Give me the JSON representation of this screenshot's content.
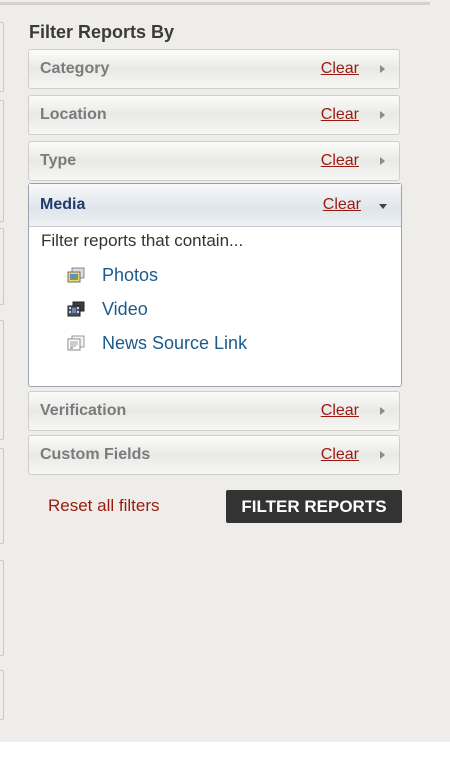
{
  "panel": {
    "title": "Filter Reports By",
    "filters": [
      {
        "label": "Category",
        "clear": "Clear"
      },
      {
        "label": "Location",
        "clear": "Clear"
      },
      {
        "label": "Type",
        "clear": "Clear"
      },
      {
        "label": "Media",
        "clear": "Clear",
        "expanded": true
      },
      {
        "label": "Verification",
        "clear": "Clear"
      },
      {
        "label": "Custom Fields",
        "clear": "Clear"
      }
    ],
    "media": {
      "intro": "Filter reports that contain...",
      "options": [
        {
          "label": "Photos",
          "icon": "photos-icon"
        },
        {
          "label": "Video",
          "icon": "video-icon"
        },
        {
          "label": "News Source Link",
          "icon": "news-link-icon"
        }
      ]
    },
    "reset_label": "Reset all filters",
    "submit_label": "FILTER REPORTS"
  },
  "colors": {
    "clear_link": "#9b1a0f",
    "media_header_text": "#243a6a",
    "option_link": "#1d5a8a",
    "submit_bg": "#333333"
  }
}
